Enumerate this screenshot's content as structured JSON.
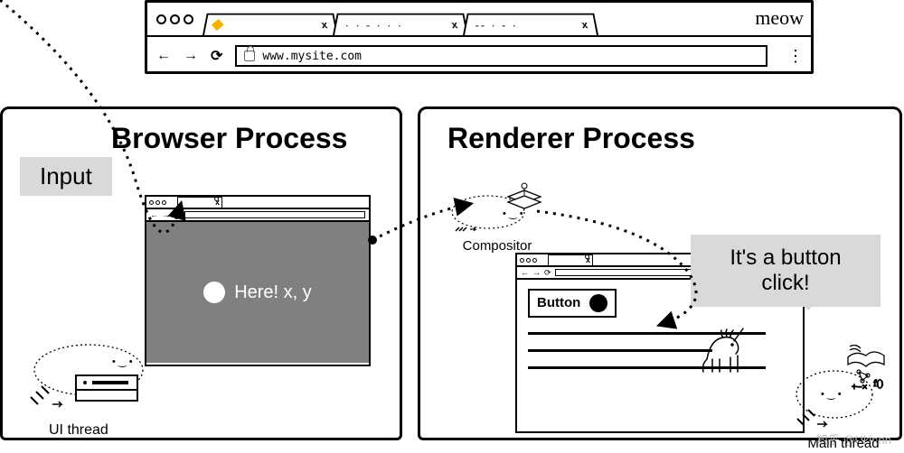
{
  "browser_chrome": {
    "brand": "meow",
    "tabs": [
      {
        "label": "",
        "close": "x",
        "active": true
      },
      {
        "label": "· · - · · ·",
        "close": "x",
        "active": false
      },
      {
        "label": "-- · - ·",
        "close": "x",
        "active": false
      }
    ],
    "nav": {
      "back": "←",
      "forward": "→",
      "reload": "⟳"
    },
    "url": "www.mysite.com",
    "menu_icon": "⋮"
  },
  "panels": {
    "browser": {
      "title": "Browser Process"
    },
    "renderer": {
      "title": "Renderer Process"
    }
  },
  "labels": {
    "input": "Input",
    "compositor": "Compositor",
    "ui_thread": "UI thread",
    "main_thread": "Main thread"
  },
  "hit_target": {
    "text": "Here! x, y"
  },
  "rendered_page": {
    "button_label": "Button"
  },
  "speech_bubble": "It's a button click!",
  "watermark": "知乎 @Ukinnn"
}
